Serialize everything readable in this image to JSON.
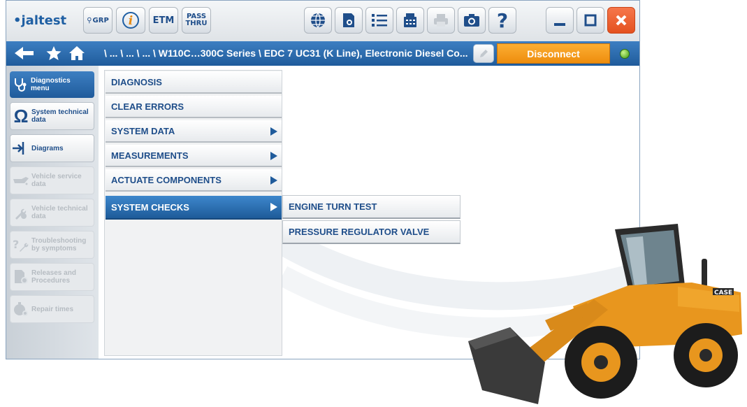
{
  "toolbar": {
    "logo_text": "jaltest",
    "grp_label": "GRP",
    "etm_label": "ETM",
    "pass_label": "PASS",
    "thru_label": "THRU"
  },
  "navbar": {
    "path": "\\ ... \\ ... \\ ... \\ W110C…300C Series \\ EDC 7 UC31 (K Line), Electronic Diesel Co...",
    "disconnect_label": "Disconnect"
  },
  "sidebar": {
    "items": [
      {
        "label_line1": "Diagnostics",
        "label_line2": "menu",
        "state": "active"
      },
      {
        "label_line1": "System technical",
        "label_line2": "data",
        "state": "normal"
      },
      {
        "label_line1": "Diagrams",
        "label_line2": "",
        "state": "normal"
      },
      {
        "label_line1": "Vehicle service",
        "label_line2": "data",
        "state": "disabled"
      },
      {
        "label_line1": "Vehicle technical",
        "label_line2": "data",
        "state": "disabled"
      },
      {
        "label_line1": "Troubleshooting",
        "label_line2": "by symptoms",
        "state": "disabled"
      },
      {
        "label_line1": "Releases and",
        "label_line2": "Procedures",
        "state": "disabled"
      },
      {
        "label_line1": "Repair times",
        "label_line2": "",
        "state": "disabled"
      }
    ]
  },
  "menu": {
    "items": [
      {
        "label": "DIAGNOSIS"
      },
      {
        "label": "CLEAR ERRORS"
      },
      {
        "label": "SYSTEM DATA"
      },
      {
        "label": "MEASUREMENTS"
      },
      {
        "label": "ACTUATE COMPONENTS"
      },
      {
        "label": "SYSTEM CHECKS"
      }
    ]
  },
  "submenu": {
    "items": [
      {
        "label": "ENGINE TURN TEST"
      },
      {
        "label": "PRESSURE REGULATOR VALVE"
      }
    ]
  },
  "colors": {
    "accent_blue": "#1f5b9b",
    "disconnect_orange": "#f39a1a",
    "close_red": "#e4511f",
    "status_green": "#3c9b11"
  }
}
